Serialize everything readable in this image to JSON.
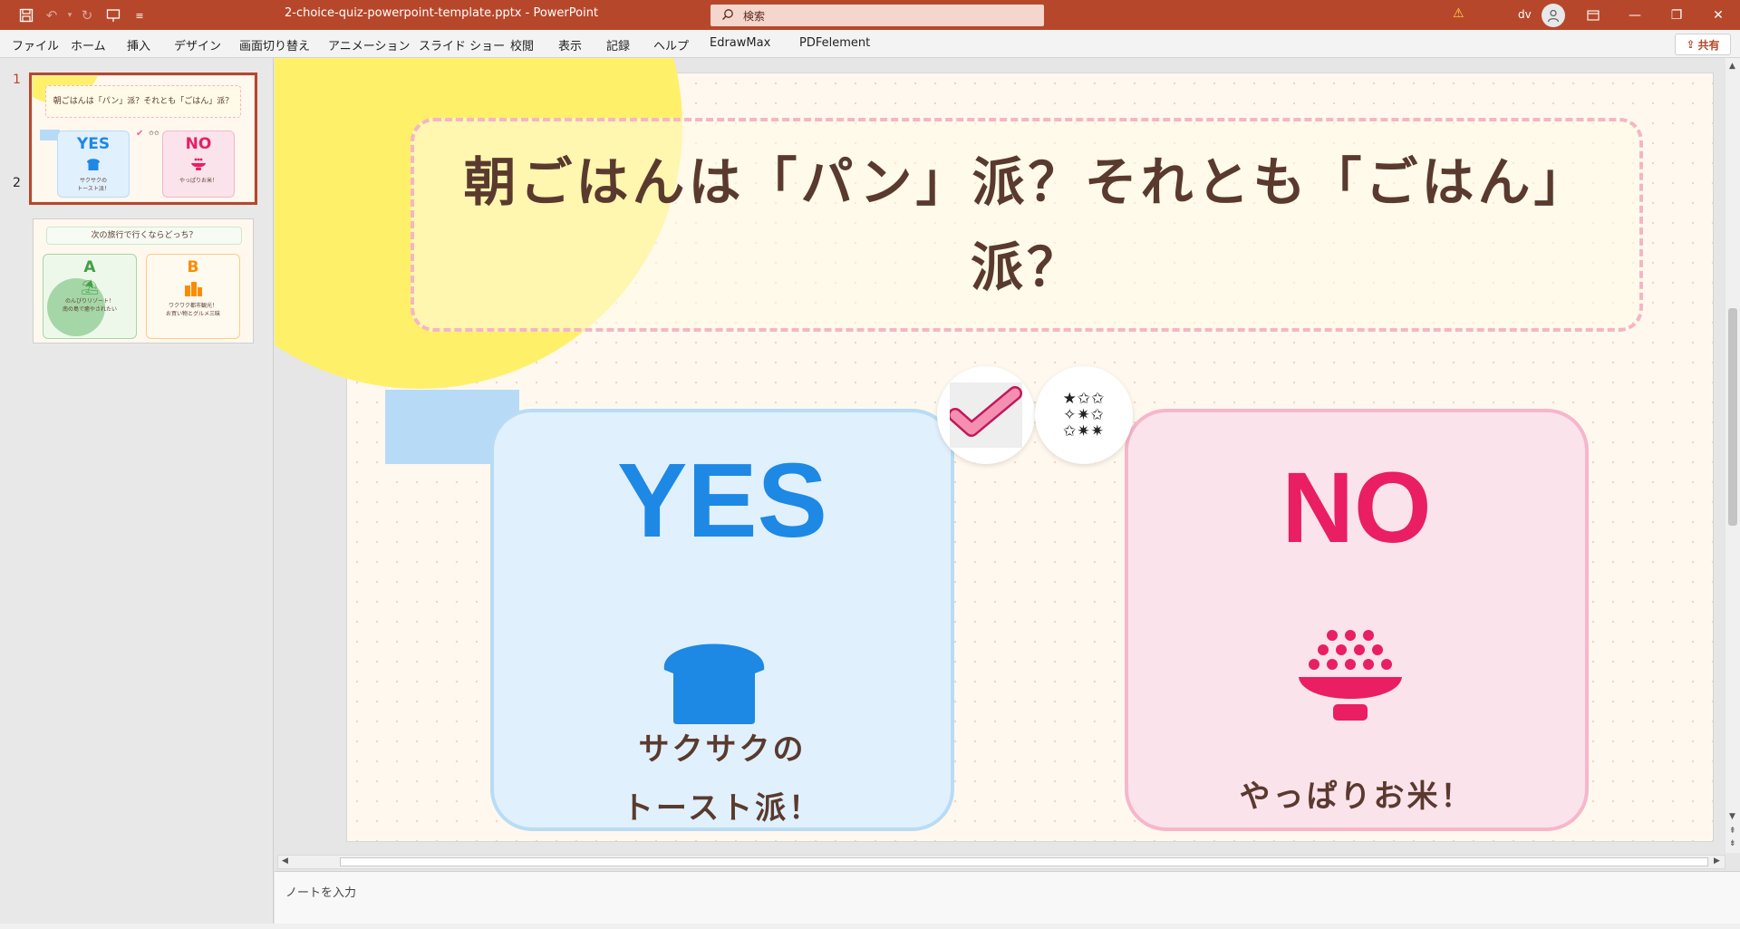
{
  "window": {
    "title": "2-choice-quiz-powerpoint-template.pptx  -  PowerPoint",
    "search_placeholder": "検索",
    "user_initials": "dv",
    "accent": "#b7472a"
  },
  "quick_access": [
    "save-icon",
    "undo-icon",
    "redo-icon",
    "present-icon",
    "customize-icon"
  ],
  "menu": {
    "items": [
      "ファイル",
      "ホーム",
      "挿入",
      "デザイン",
      "画面切り替え",
      "アニメーション",
      "スライド ショー",
      "校閲",
      "表示",
      "記録",
      "ヘルプ",
      "EdrawMax",
      "PDFelement"
    ],
    "share": "共有"
  },
  "thumbnails": [
    {
      "number": "1",
      "title": "朝ごはんは「パン」派？それとも「ごはん」派？",
      "left_label": "YES",
      "left_sub": "サクサクの\nトースト派！",
      "right_label": "NO",
      "right_sub": "やっぱりお米！"
    },
    {
      "number": "2",
      "title": "次の旅行で行くならどっち？",
      "left_label": "A",
      "left_sub": "のんびりリゾート！\n南の島で癒やされたい",
      "right_label": "B",
      "right_sub": "ワクワク都市観光！\nお買い物とグルメ三昧"
    }
  ],
  "slide": {
    "question": "朝ごはんは「パン」派？それとも「ごはん」派？",
    "yes": {
      "label": "YES",
      "sub_line1": "サクサクの",
      "sub_line2": "トースト派！",
      "color": "#1e88e5",
      "icon": "toast-icon"
    },
    "no": {
      "label": "NO",
      "sub_line1": "やっぱりお米！",
      "color": "#e91e63",
      "icon": "rice-bowl-icon"
    },
    "badges": [
      "checkmark-icon",
      "stars-icon"
    ]
  },
  "notes": {
    "placeholder": "ノートを入力"
  }
}
